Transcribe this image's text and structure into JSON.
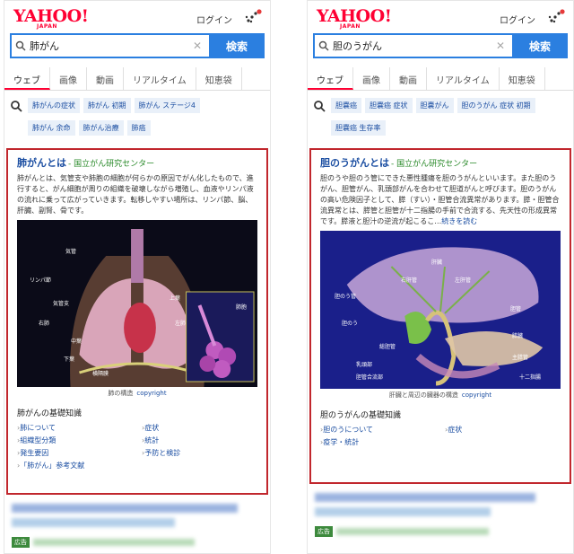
{
  "left": {
    "logo": "YAHOO!",
    "logo_sub": "JAPAN",
    "login": "ログイン",
    "query": "肺がん",
    "search_button": "検索",
    "tabs": [
      "ウェブ",
      "画像",
      "動画",
      "リアルタイム",
      "知恵袋"
    ],
    "related_row1": [
      "肺がんの症状",
      "肺がん 初期",
      "肺がん ステージ4"
    ],
    "related_row2": [
      "肺がん 余命",
      "肺がん治療",
      "肺癌"
    ],
    "card": {
      "title": "肺がんとは",
      "source": "- 国立がん研究センター",
      "body": "肺がんとは、気管支や肺胞の細胞が何らかの原因でがん化したもので、進行すると、がん細胞が周りの組織を破壊しながら増殖し、血液やリンパ液の流れに乗って広がっていきます。転移しやすい場所は、リンパ節、脳、肝臓、副腎、骨です。",
      "figure_labels": [
        "気管",
        "気管支",
        "リンパ節",
        "右肺",
        "左肺",
        "肺胞",
        "上葉",
        "中葉",
        "下葉",
        "横隔膜"
      ],
      "caption": "肺の構造",
      "copyright": "copyright",
      "basics_title": "肺がんの基礎知識",
      "basics": [
        "肺について",
        "症状",
        "組織型分類",
        "統計",
        "発生要因",
        "予防と検診",
        "「肺がん」参考文献"
      ]
    },
    "ad_badge": "広告"
  },
  "right": {
    "logo": "YAHOO!",
    "logo_sub": "JAPAN",
    "login": "ログイン",
    "query": "胆のうがん",
    "search_button": "検索",
    "tabs": [
      "ウェブ",
      "画像",
      "動画",
      "リアルタイム",
      "知恵袋"
    ],
    "related_row1": [
      "胆嚢癌",
      "胆嚢癌 症状",
      "胆嚢がん",
      "胆のうがん 症状 初期"
    ],
    "related_row2": [
      "胆嚢癌 生存率"
    ],
    "card": {
      "title": "胆のうがんとは",
      "source": "- 国立がん研究センター",
      "body": "胆のうや胆のう管にできた悪性腫瘍を胆のうがんといいます。また胆のうがん、胆管がん、乳頭部がんを合わせて胆道がんと呼びます。胆のうがんの高い危険因子として、膵（すい）・胆管合流異常があります。膵・胆管合流異常とは、膵管と胆管が十二指腸の手前で合流する、先天性の形成異常です。膵液と胆汁の逆流が起こるこ…",
      "more": "続きを読む",
      "figure_labels": [
        "肝臓",
        "胆のう管",
        "胆のう",
        "右肝管",
        "左肝管",
        "胆管",
        "十二指腸",
        "膵臓",
        "主膵管",
        "総胆管",
        "乳頭部",
        "胆管合流部"
      ],
      "caption": "肝臓と周辺の臓器の構造",
      "copyright": "copyright",
      "basics_title": "胆のうがんの基礎知識",
      "basics": [
        "胆のうについて",
        "症状",
        "疫学・統計"
      ]
    },
    "ad_badge": "広告"
  }
}
